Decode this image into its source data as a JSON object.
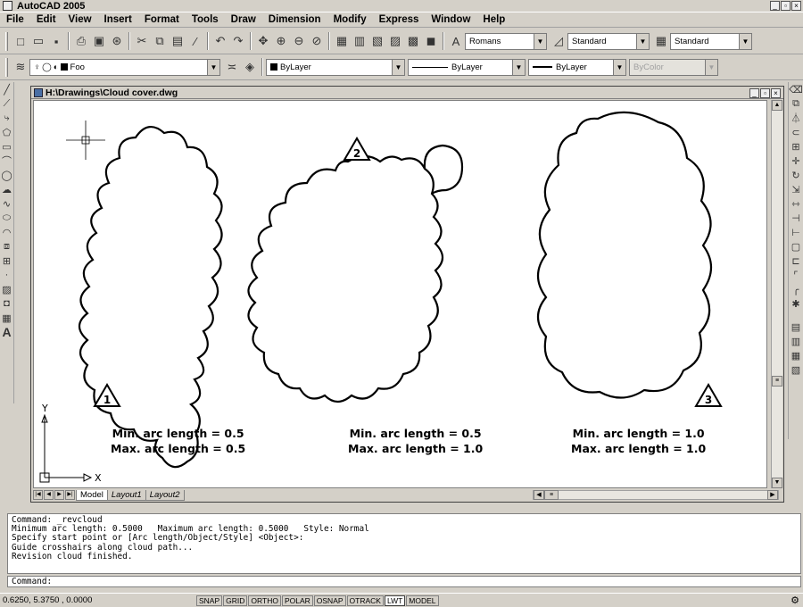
{
  "app": {
    "title": "AutoCAD 2005"
  },
  "menu": [
    "File",
    "Edit",
    "View",
    "Insert",
    "Format",
    "Tools",
    "Draw",
    "Dimension",
    "Modify",
    "Express",
    "Window",
    "Help"
  ],
  "styles_toolbar": {
    "text_style": "Romans",
    "dim_style": "Standard",
    "table_style": "Standard"
  },
  "layers_toolbar": {
    "layer": "Foo",
    "color": "ByLayer",
    "linetype": "ByLayer",
    "lineweight": "ByLayer",
    "plotstyle": "ByColor"
  },
  "drawing": {
    "title": "H:\\Drawings\\Cloud cover.dwg",
    "clouds": [
      {
        "tag": "1",
        "line1": "Min. arc length = 0.5",
        "line2": "Max. arc length = 0.5"
      },
      {
        "tag": "2",
        "line1": "Min. arc length = 0.5",
        "line2": "Max. arc length = 1.0"
      },
      {
        "tag": "3",
        "line1": "Min. arc length = 1.0",
        "line2": "Max. arc length = 1.0"
      }
    ],
    "ucs": {
      "x": "X",
      "y": "Y"
    },
    "tabs": [
      "Model",
      "Layout1",
      "Layout2"
    ]
  },
  "command": {
    "history": [
      "Command: _revcloud",
      "Minimum arc length: 0.5000   Maximum arc length: 0.5000   Style: Normal",
      "Specify start point or [Arc length/Object/Style] <Object>:",
      "Guide crosshairs along cloud path...",
      "Revision cloud finished."
    ],
    "prompt": "Command:"
  },
  "status": {
    "coords": "0.6250, 5.3750 , 0.0000",
    "toggles": [
      "SNAP",
      "GRID",
      "ORTHO",
      "POLAR",
      "OSNAP",
      "OTRACK",
      "LWT",
      "MODEL"
    ]
  }
}
